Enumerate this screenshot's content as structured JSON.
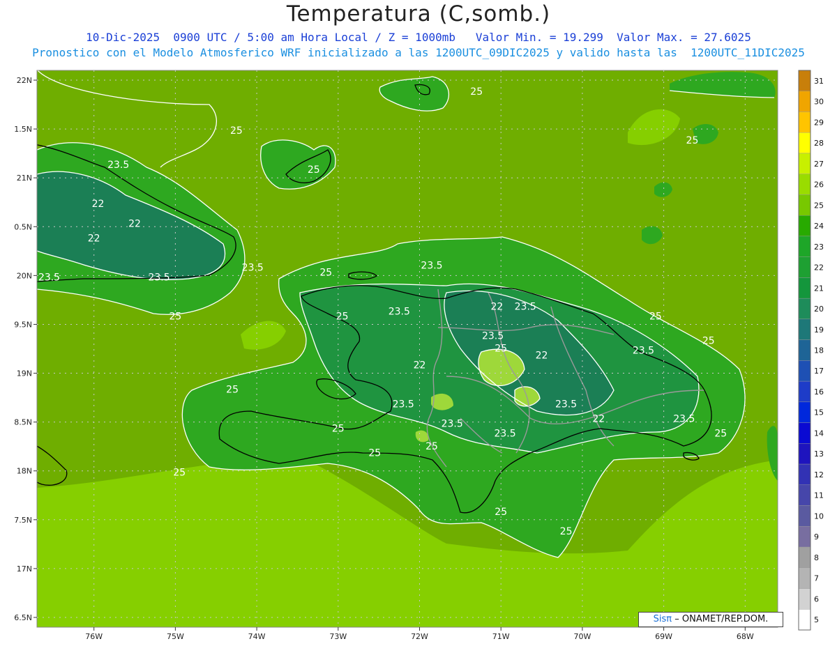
{
  "header": {
    "title": "Temperatura (C,somb.)",
    "line1": "10-Dic-2025  0900 UTC / 5:00 am Hora Local / Z = 1000mb   Valor Min. = 19.299  Valor Max. = 27.6025",
    "line2": "Pronostico con el Modelo Atmosferico WRF inicializado a las 1200UTC_09DIC2025 y valido hasta las  1200UTC_11DIC2025"
  },
  "map": {
    "lon_range": [
      -76.7,
      -67.6
    ],
    "lat_range": [
      16.4,
      22.1
    ],
    "lat_labels": [
      "22N",
      "1.5N",
      "21N",
      "0.5N",
      "20N",
      "9.5N",
      "19N",
      "8.5N",
      "18N",
      "7.5N",
      "17N",
      "6.5N"
    ],
    "lat_values": [
      22.0,
      21.5,
      21.0,
      20.5,
      20.0,
      19.5,
      19.0,
      18.5,
      18.0,
      17.5,
      17.0,
      16.5
    ],
    "lon_labels": [
      "76W",
      "75W",
      "74W",
      "73W",
      "72W",
      "71W",
      "70W",
      "69W",
      "68W"
    ],
    "lon_values": [
      -76,
      -75,
      -74,
      -73,
      -72,
      -71,
      -70,
      -69,
      -68
    ],
    "contour_labels": [
      {
        "text": "25",
        "lon": -71.3,
        "lat": 21.85
      },
      {
        "text": "25",
        "lon": -74.25,
        "lat": 21.45
      },
      {
        "text": "25",
        "lon": -73.3,
        "lat": 21.05
      },
      {
        "text": "25",
        "lon": -68.65,
        "lat": 21.35
      },
      {
        "text": "23.5",
        "lon": -75.7,
        "lat": 21.1
      },
      {
        "text": "22",
        "lon": -75.95,
        "lat": 20.7
      },
      {
        "text": "22",
        "lon": -75.5,
        "lat": 20.5
      },
      {
        "text": "22",
        "lon": -76.0,
        "lat": 20.35
      },
      {
        "text": "23.5",
        "lon": -76.55,
        "lat": 19.95
      },
      {
        "text": "23.5",
        "lon": -74.05,
        "lat": 20.05
      },
      {
        "text": "23.5",
        "lon": -75.2,
        "lat": 19.95
      },
      {
        "text": "25",
        "lon": -75.0,
        "lat": 19.55
      },
      {
        "text": "25",
        "lon": -73.15,
        "lat": 20.0
      },
      {
        "text": "23.5",
        "lon": -71.85,
        "lat": 20.07
      },
      {
        "text": "25",
        "lon": -72.95,
        "lat": 19.55
      },
      {
        "text": "23.5",
        "lon": -72.25,
        "lat": 19.6
      },
      {
        "text": "22",
        "lon": -71.05,
        "lat": 19.65
      },
      {
        "text": "23.5",
        "lon": -70.7,
        "lat": 19.65
      },
      {
        "text": "23.5",
        "lon": -71.1,
        "lat": 19.35
      },
      {
        "text": "25",
        "lon": -71.0,
        "lat": 19.22
      },
      {
        "text": "22",
        "lon": -70.5,
        "lat": 19.15
      },
      {
        "text": "22",
        "lon": -72.0,
        "lat": 19.05
      },
      {
        "text": "23.5",
        "lon": -69.25,
        "lat": 19.2
      },
      {
        "text": "25",
        "lon": -69.1,
        "lat": 19.55
      },
      {
        "text": "25",
        "lon": -68.45,
        "lat": 19.3
      },
      {
        "text": "25",
        "lon": -74.3,
        "lat": 18.8
      },
      {
        "text": "23.5",
        "lon": -72.2,
        "lat": 18.65
      },
      {
        "text": "23.5",
        "lon": -70.2,
        "lat": 18.65
      },
      {
        "text": "22",
        "lon": -69.8,
        "lat": 18.5
      },
      {
        "text": "23.5",
        "lon": -68.75,
        "lat": 18.5
      },
      {
        "text": "25",
        "lon": -68.3,
        "lat": 18.35
      },
      {
        "text": "23.5",
        "lon": -71.6,
        "lat": 18.45
      },
      {
        "text": "23.5",
        "lon": -70.95,
        "lat": 18.35
      },
      {
        "text": "25",
        "lon": -73.0,
        "lat": 18.4
      },
      {
        "text": "25",
        "lon": -72.55,
        "lat": 18.15
      },
      {
        "text": "25",
        "lon": -71.85,
        "lat": 18.22
      },
      {
        "text": "25",
        "lon": -74.95,
        "lat": 17.95
      },
      {
        "text": "25",
        "lon": -71.0,
        "lat": 17.55
      },
      {
        "text": "25",
        "lon": -70.2,
        "lat": 17.35
      }
    ]
  },
  "legend": {
    "levels": [
      "31",
      "30",
      "29",
      "28",
      "27",
      "26",
      "25",
      "24",
      "23",
      "22",
      "21",
      "20",
      "19",
      "18",
      "17",
      "16",
      "15",
      "14",
      "13",
      "12",
      "11",
      "10",
      "9",
      "8",
      "7",
      "6",
      "5"
    ],
    "colors": [
      "#c87f0a",
      "#f0a500",
      "#ffc400",
      "#ffff00",
      "#c8f000",
      "#9adc00",
      "#78c800",
      "#28aa00",
      "#1ea628",
      "#1ea032",
      "#14963c",
      "#1e8c5a",
      "#1e7878",
      "#1e6496",
      "#1e50b4",
      "#1e3cc8",
      "#0028dc",
      "#0a0ad2",
      "#1e14be",
      "#3232b4",
      "#4646aa",
      "#5a5aa0",
      "#786ea0",
      "#a0a0a0",
      "#b4b4b4",
      "#d2d2d2",
      "#ffffff"
    ]
  },
  "credit": {
    "brand": "Sisπ",
    "text": "– ONAMET/REP.DOM."
  },
  "colors": {
    "sea_warm": "#6fae00",
    "sea_cool": "#86cf00",
    "land_mid": "#2ea820",
    "land_cool": "#1f9440",
    "land_cold": "#1b7f55",
    "hot_spot": "#9ed83a",
    "coast": "#000000",
    "border": "#9a9a9a",
    "contour": "#ffffff"
  }
}
